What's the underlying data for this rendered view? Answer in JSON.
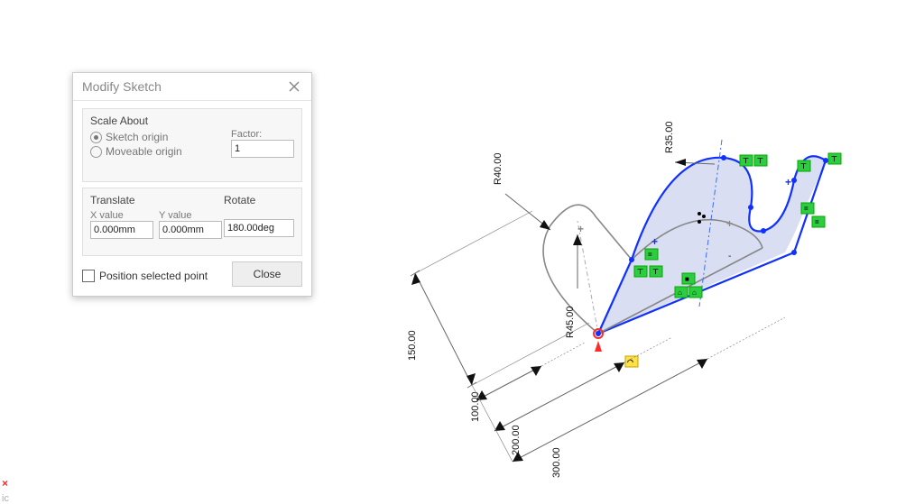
{
  "dialog": {
    "title": "Modify Sketch",
    "scale": {
      "label": "Scale About",
      "opt1": "Sketch origin",
      "opt2": "Moveable origin",
      "factor_lbl": "Factor:",
      "factor": "1"
    },
    "translate": {
      "label": "Translate",
      "x_lbl": "X value",
      "y_lbl": "Y value",
      "x": "0.000mm",
      "y": "0.000mm"
    },
    "rotate": {
      "label": "Rotate",
      "value": "180.00deg"
    },
    "position": "Position selected point",
    "close": "Close"
  },
  "dims": {
    "d150": "150.00",
    "d100": "100.00",
    "d200": "200.00",
    "d300": "300.00",
    "r40": "R40.00",
    "r45": "R45.00",
    "r35": "R35.00"
  },
  "footer": {
    "caret": "×",
    "ic": "ic"
  },
  "glyph": {
    "eq": "=",
    "t": "⊤",
    "lock": "■",
    "clamp": "⌂",
    "arc": "◠"
  }
}
